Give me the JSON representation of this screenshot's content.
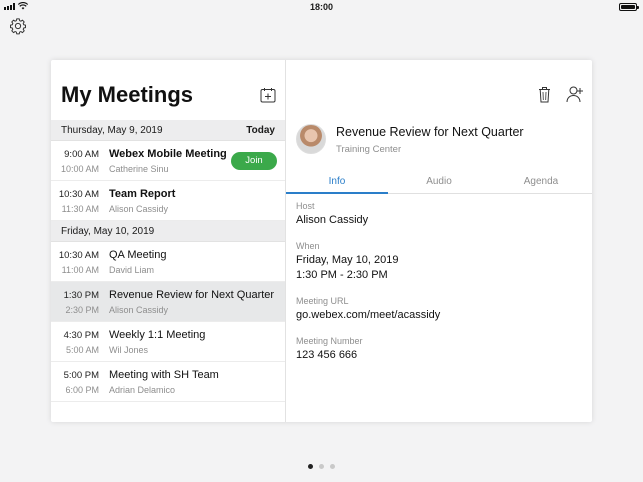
{
  "status": {
    "time": "18:00"
  },
  "left_panel": {
    "title": "My Meetings",
    "days": [
      {
        "date": "Thursday, May 9, 2019",
        "badge": "Today",
        "meetings": [
          {
            "start": "9:00 AM",
            "end": "10:00 AM",
            "title": "Webex Mobile Meeting",
            "host": "Catherine Sinu",
            "action": "Join"
          },
          {
            "start": "10:30 AM",
            "end": "11:30 AM",
            "title": "Team Report",
            "host": "Alison Cassidy"
          }
        ]
      },
      {
        "date": "Friday, May 10, 2019",
        "meetings": [
          {
            "start": "10:30 AM",
            "end": "11:00 AM",
            "title": "QA Meeting",
            "host": "David Liam"
          },
          {
            "start": "1:30 PM",
            "end": "2:30 PM",
            "title": "Revenue Review for Next Quarter",
            "host": "Alison Cassidy"
          },
          {
            "start": "4:30 PM",
            "end": "5:00 AM",
            "title": "Weekly 1:1 Meeting",
            "host": "Wil Jones"
          },
          {
            "start": "5:00 PM",
            "end": "6:00 PM",
            "title": "Meeting with SH Team",
            "host": "Adrian Delamico"
          }
        ]
      }
    ]
  },
  "detail": {
    "title": "Revenue Review for Next Quarter",
    "subtitle": "Training Center",
    "tabs": [
      "Info",
      "Audio",
      "Agenda"
    ],
    "fields": {
      "host_label": "Host",
      "host_value": "Alison Cassidy",
      "when_label": "When",
      "when_date": "Friday, May 10, 2019",
      "when_time": "1:30 PM - 2:30 PM",
      "url_label": "Meeting URL",
      "url_value": "go.webex.com/meet/acassidy",
      "number_label": "Meeting Number",
      "number_value": "123 456 666"
    }
  },
  "colors": {
    "accent": "#2a7ec9",
    "join": "#3ba94a"
  },
  "icons": [
    "gear-icon",
    "add-calendar-icon",
    "trash-icon",
    "add-person-icon",
    "wifi-icon",
    "battery-icon"
  ]
}
